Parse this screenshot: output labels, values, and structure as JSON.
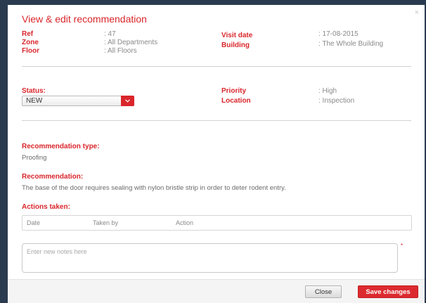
{
  "modal": {
    "title": "View & edit recommendation",
    "close_glyph": "×"
  },
  "details": {
    "ref": {
      "label": "Ref",
      "value": ": 47"
    },
    "zone": {
      "label": "Zone",
      "value": ": All Departments"
    },
    "floor": {
      "label": "Floor",
      "value": ": All Floors"
    },
    "visit_date": {
      "label": "Visit date",
      "value": ": 17-08-2015"
    },
    "building": {
      "label": "Building",
      "value": ": The Whole Building"
    }
  },
  "status": {
    "label": "Status:",
    "selected": "NEW"
  },
  "priority": {
    "label": "Priority",
    "value": ": High"
  },
  "location": {
    "label": "Location",
    "value": ": Inspection"
  },
  "recommendation_type": {
    "label": "Recommendation type:",
    "value": "Proofing"
  },
  "recommendation": {
    "label": "Recommendation:",
    "text": "The base of the door requires sealing with nylon bristle strip in order to deter rodent entry."
  },
  "actions": {
    "label": "Actions taken:",
    "columns": [
      "Date",
      "Taken by",
      "Action"
    ]
  },
  "notes": {
    "placeholder": "Enter new notes here",
    "required_mark": "*"
  },
  "footer": {
    "close_label": "Close",
    "save_label": "Save changes"
  },
  "colors": {
    "accent": "#d9262b",
    "backdrop": "#2b3b4f"
  }
}
